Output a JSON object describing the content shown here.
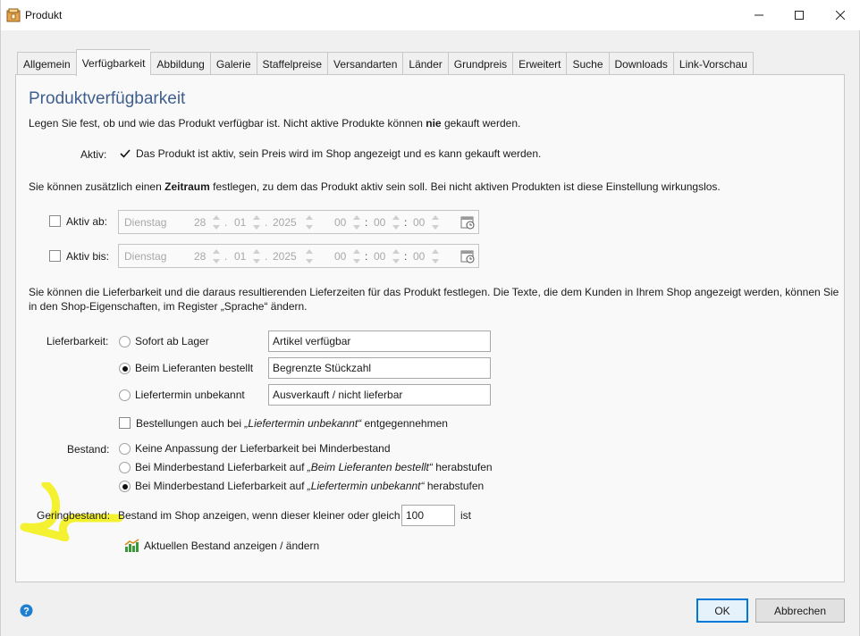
{
  "window": {
    "title": "Produkt"
  },
  "tabs": [
    "Allgemein",
    "Verfügbarkeit",
    "Abbildung",
    "Galerie",
    "Staffelpreise",
    "Versandarten",
    "Länder",
    "Grundpreis",
    "Erweitert",
    "Suche",
    "Downloads",
    "Link-Vorschau"
  ],
  "active_tab": "Verfügbarkeit",
  "page": {
    "heading": "Produktverfügbarkeit",
    "intro": {
      "before": "Legen Sie fest, ob und wie das Produkt verfügbar ist. Nicht aktive Produkte können ",
      "bold": "nie",
      "after": " gekauft werden."
    },
    "aktiv": {
      "label": "Aktiv:",
      "checked": true,
      "text": "Das Produkt ist aktiv, sein Preis wird im Shop angezeigt und es kann gekauft werden."
    },
    "zeitraum_text": {
      "before": "Sie können zusätzlich einen ",
      "bold": "Zeitraum",
      "after": " festlegen, zu dem das Produkt aktiv sein soll. Bei nicht aktiven Produkten ist diese Einstellung wirkungslos."
    },
    "aktiv_ab": {
      "label": "Aktiv ab:",
      "checked": false,
      "weekday": "Dienstag",
      "day": "28",
      "month": "01",
      "year": "2025",
      "hour": "00",
      "minute": "00",
      "second": "00",
      "sep_date": ".",
      "sep_time": ":"
    },
    "aktiv_bis": {
      "label": "Aktiv bis:",
      "checked": false,
      "weekday": "Dienstag",
      "day": "28",
      "month": "01",
      "year": "2025",
      "hour": "00",
      "minute": "00",
      "second": "00",
      "sep_date": ".",
      "sep_time": ":"
    },
    "lieferbarkeit_text_line1": "Sie können die Lieferbarkeit und die daraus resultierenden Lieferzeiten für das Produkt festlegen. Die Texte, die dem Kunden in Ihrem Shop angezeigt werden, können Sie",
    "lieferbarkeit_text_line2": "in den Shop-Eigenschaften, im Register „Sprache“ ändern.",
    "lieferbarkeit": {
      "label": "Lieferbarkeit:",
      "options": [
        {
          "label": "Sofort ab Lager",
          "selected": false,
          "text": "Artikel verfügbar"
        },
        {
          "label": "Beim Lieferanten bestellt",
          "selected": true,
          "text": "Begrenzte Stückzahl"
        },
        {
          "label": "Liefertermin unbekannt",
          "selected": false,
          "text": "Ausverkauft / nicht lieferbar"
        }
      ],
      "orders_checkbox": {
        "checked": false,
        "before": "Bestellungen auch bei ",
        "italic": "„Liefertermin unbekannt“",
        "after": " entgegennehmen"
      }
    },
    "bestand": {
      "label": "Bestand:",
      "options": [
        {
          "selected": false,
          "before": "Keine Anpassung der Lieferbarkeit bei Minderbestand",
          "italic": "",
          "after": ""
        },
        {
          "selected": false,
          "before": "Bei Minderbestand Lieferbarkeit auf ",
          "italic": "„Beim Lieferanten bestellt“",
          "after": " herabstufen"
        },
        {
          "selected": true,
          "before": "Bei Minderbestand Lieferbarkeit auf ",
          "italic": "„Liefertermin unbekannt“",
          "after": " herabstufen"
        }
      ]
    },
    "geringbestand": {
      "label": "Geringbestand:",
      "text_before": "Bestand im Shop anzeigen, wenn dieser kleiner oder gleich",
      "value": "100",
      "text_after": "ist"
    },
    "stock_link": "Aktuellen Bestand anzeigen / ändern"
  },
  "footer": {
    "ok": "OK",
    "cancel": "Abbrechen"
  },
  "colors": {
    "heading": "#3f5f8f",
    "accent": "#0078d7",
    "highlight": "#f2f01a"
  }
}
